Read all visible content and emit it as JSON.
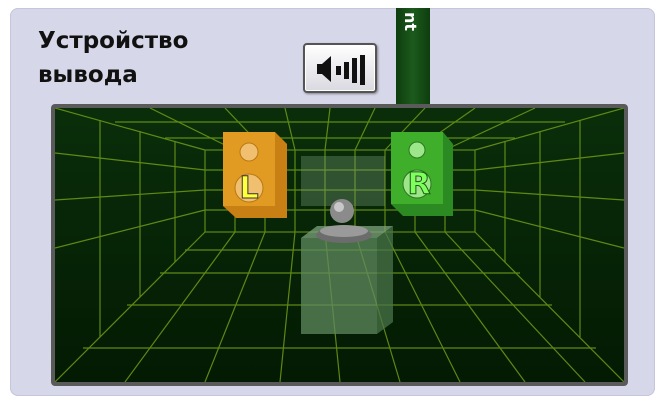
{
  "panel": {
    "title_line1": "Устройство",
    "title_line2": "вывода"
  },
  "green_tab": {
    "label": "nt"
  },
  "speaker_button": {
    "icon": "speaker-volume-icon"
  },
  "stage": {
    "left_speaker_label": "L",
    "right_speaker_label": "R",
    "colors": {
      "background": "#052205",
      "grid": "#6f9a18",
      "left_speaker": "#e19a22",
      "right_speaker": "#3fae2a",
      "label_left": "#ffff3a",
      "label_right": "#7dff5c"
    }
  }
}
